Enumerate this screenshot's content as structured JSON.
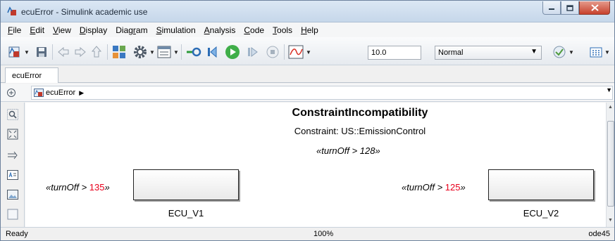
{
  "window": {
    "title": "ecuError - Simulink academic use"
  },
  "menu": [
    {
      "key": "F",
      "rest": "ile"
    },
    {
      "key": "E",
      "rest": "dit"
    },
    {
      "key": "V",
      "rest": "iew"
    },
    {
      "key": "D",
      "rest": "isplay"
    },
    {
      "pre": "Diag",
      "key": "r",
      "rest": "am"
    },
    {
      "key": "S",
      "rest": "imulation"
    },
    {
      "key": "A",
      "rest": "nalysis"
    },
    {
      "key": "C",
      "rest": "ode"
    },
    {
      "key": "T",
      "rest": "ools"
    },
    {
      "key": "H",
      "rest": "elp"
    }
  ],
  "toolbar": {
    "stop_time": "10.0",
    "sim_mode": "Normal",
    "icons": [
      "library-browser-icon",
      "save-icon",
      "back-icon",
      "forward-icon",
      "up-icon",
      "model-explorer-icon",
      "settings-icon",
      "data-import-icon",
      "build-icon",
      "step-back-icon",
      "run-icon",
      "step-forward-icon",
      "stop-icon",
      "scope-icon",
      "check-icon",
      "status-grid-icon"
    ]
  },
  "tab": {
    "label": "ecuError"
  },
  "address": {
    "path": "ecuError"
  },
  "canvas": {
    "title": "ConstraintIncompatibility",
    "constraint": "Constraint: US::EmissionControl",
    "top_condition": "«turnOff > 128»",
    "blocks": [
      {
        "name": "ECU_V1",
        "cond_prefix": "«turnOff > ",
        "cond_value": "135",
        "cond_suffix": "»"
      },
      {
        "name": "ECU_V2",
        "cond_prefix": "«turnOff > ",
        "cond_value": "125",
        "cond_suffix": "»"
      }
    ]
  },
  "status": {
    "state": "Ready",
    "zoom": "100%",
    "solver": "ode45"
  }
}
